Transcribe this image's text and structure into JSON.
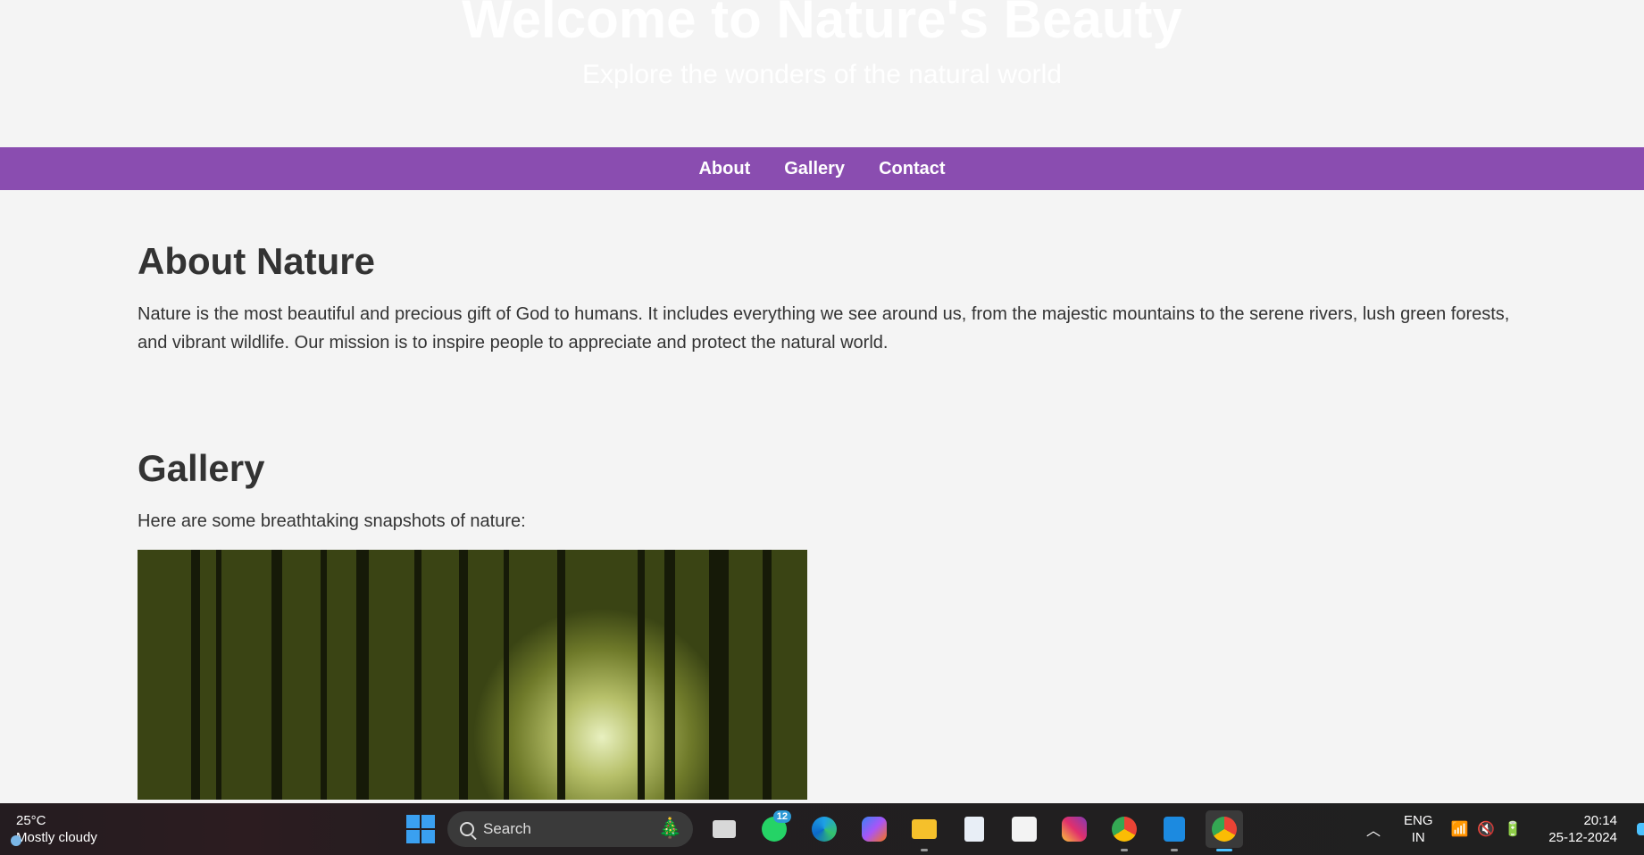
{
  "hero": {
    "title": "Welcome to Nature's Beauty",
    "subtitle": "Explore the wonders of the natural world"
  },
  "nav": {
    "items": [
      {
        "label": "About"
      },
      {
        "label": "Gallery"
      },
      {
        "label": "Contact"
      }
    ]
  },
  "about": {
    "heading": "About Nature",
    "text": "Nature is the most beautiful and precious gift of God to humans. It includes everything we see around us, from the majestic mountains to the serene rivers, lush green forests, and vibrant wildlife. Our mission is to inspire people to appreciate and protect the natural world."
  },
  "gallery": {
    "heading": "Gallery",
    "intro": "Here are some breathtaking snapshots of nature:"
  },
  "taskbar": {
    "weather_temp": "25°C",
    "weather_desc": "Mostly cloudy",
    "search_label": "Search",
    "whatsapp_badge": "12",
    "lang_top": "ENG",
    "lang_bottom": "IN",
    "time": "20:14",
    "date": "25-12-2024",
    "apps": [
      "task-view",
      "whatsapp",
      "edge",
      "copilot",
      "file-explorer",
      "notepad",
      "microsoft-store",
      "instagram",
      "chrome-profile",
      "vscode",
      "chrome"
    ]
  },
  "colors": {
    "nav_bg": "#8a4db0",
    "page_bg": "#f4f4f4",
    "text": "#333333"
  }
}
